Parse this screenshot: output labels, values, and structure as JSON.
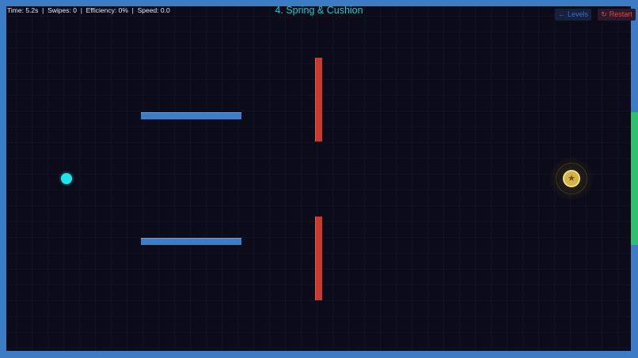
{
  "hud": {
    "time_label": "Time:",
    "time_value": "5.2s",
    "swipes_label": "Swipes:",
    "swipes_value": "0",
    "efficiency_label": "Efficiency:",
    "efficiency_value": "0%",
    "speed_label": "Speed:",
    "speed_value": "0.0",
    "separator": "|"
  },
  "level": {
    "title": "4. Spring & Cushion"
  },
  "buttons": {
    "levels_icon": "←",
    "levels_label": "Levels",
    "restart_icon": "↻",
    "restart_label": "Restart"
  },
  "game": {
    "target_icon": "star-icon",
    "target_glyph": "★"
  },
  "colors": {
    "background": "#0b0b1a",
    "wall": "#3b7cc4",
    "goal": "#2fbf71",
    "platform": "#3f7cc6",
    "spring": "#c9392f",
    "ball": "#22e3ea",
    "target": "#d4b24a",
    "title": "#2ec4c4",
    "restart": "#d94a4a"
  }
}
